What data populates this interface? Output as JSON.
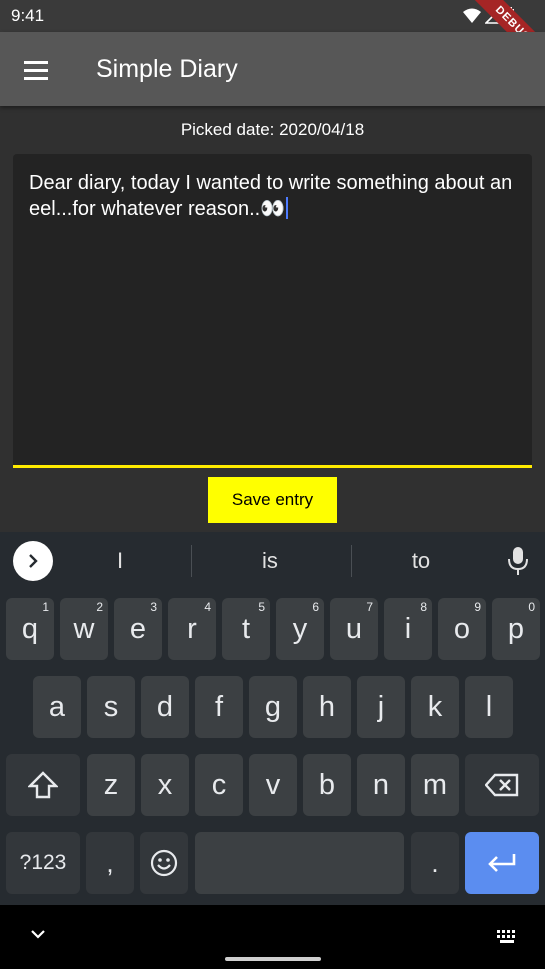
{
  "status_bar": {
    "time": "9:41",
    "debug_label": "DEBUG"
  },
  "app_bar": {
    "title": "Simple Diary",
    "menu_icon": "menu-icon"
  },
  "main": {
    "picked_date": "Picked date: 2020/04/18",
    "entry_text": "Dear diary, today I wanted to write something about an eel...for whatever reason..👀",
    "save_label": "Save entry"
  },
  "keyboard": {
    "suggestions": [
      "I",
      "is",
      "to"
    ],
    "row1": [
      {
        "k": "q",
        "n": "1"
      },
      {
        "k": "w",
        "n": "2"
      },
      {
        "k": "e",
        "n": "3"
      },
      {
        "k": "r",
        "n": "4"
      },
      {
        "k": "t",
        "n": "5"
      },
      {
        "k": "y",
        "n": "6"
      },
      {
        "k": "u",
        "n": "7"
      },
      {
        "k": "i",
        "n": "8"
      },
      {
        "k": "o",
        "n": "9"
      },
      {
        "k": "p",
        "n": "0"
      }
    ],
    "row2": [
      "a",
      "s",
      "d",
      "f",
      "g",
      "h",
      "j",
      "k",
      "l"
    ],
    "row3": [
      "z",
      "x",
      "c",
      "v",
      "b",
      "n",
      "m"
    ],
    "numbers_label": "?123",
    "comma": ",",
    "period": "."
  },
  "colors": {
    "accent": "#ffeb00",
    "save_button": "#ffff00",
    "enter_key": "#5b8df0"
  }
}
